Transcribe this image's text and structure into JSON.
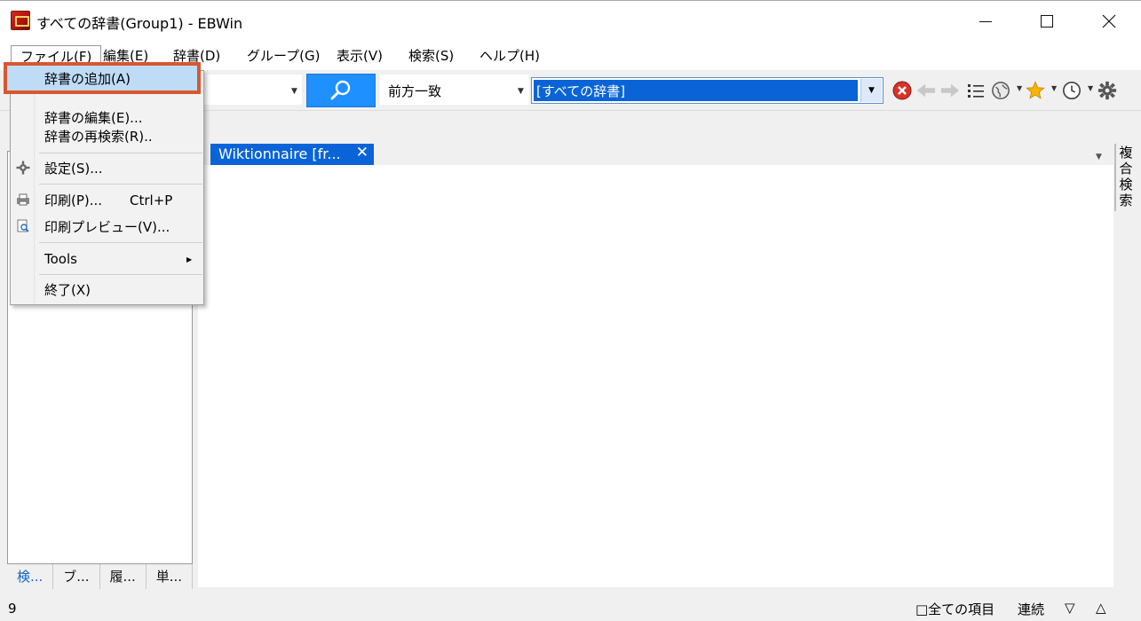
{
  "window": {
    "title": "すべての辞書(Group1) - EBWin"
  },
  "menubar": {
    "items": [
      {
        "label": "ファイル(F)"
      },
      {
        "label": "編集(E)"
      },
      {
        "label": "辞書(D)"
      },
      {
        "label": "グループ(G)"
      },
      {
        "label": "表示(V)"
      },
      {
        "label": "検索(S)"
      },
      {
        "label": "ヘルプ(H)"
      }
    ]
  },
  "toolbar": {
    "match_mode": "前方一致",
    "dictionary_group": "[すべての辞書]",
    "icons": [
      "stop-icon",
      "back-icon",
      "forward-icon",
      "list-icon",
      "web-icon",
      "favorite-icon",
      "history-icon",
      "settings-icon"
    ]
  },
  "file_menu": {
    "items": [
      {
        "label": "辞書の追加(A)",
        "highlighted": true
      },
      {
        "label": "辞書の編集(E)..."
      },
      {
        "label": "辞書の再検索(R).."
      },
      {
        "label": "設定(S)..."
      },
      {
        "label": "印刷(P)...",
        "shortcut": "Ctrl+P"
      },
      {
        "label": "印刷プレビュー(V)..."
      },
      {
        "label": "Tools"
      },
      {
        "label": "終了(X)"
      }
    ]
  },
  "left_panel": {
    "tabs": [
      {
        "label": "検..."
      },
      {
        "label": "ブ..."
      },
      {
        "label": "履..."
      },
      {
        "label": "単..."
      }
    ]
  },
  "document": {
    "tab_label": "Wiktionnaire [fr...",
    "close_glyph": "✕"
  },
  "right_panel": {
    "label": "複合検索"
  },
  "statusbar": {
    "count": "9",
    "all_items": "□全ての項目",
    "continuous": "連続",
    "down": "▽",
    "up": "△"
  },
  "colors": {
    "accent": "#0a64d8",
    "search_button": "#1e90ff",
    "highlight_border": "#d9572f",
    "highlight_fill": "#bfdcf7"
  }
}
